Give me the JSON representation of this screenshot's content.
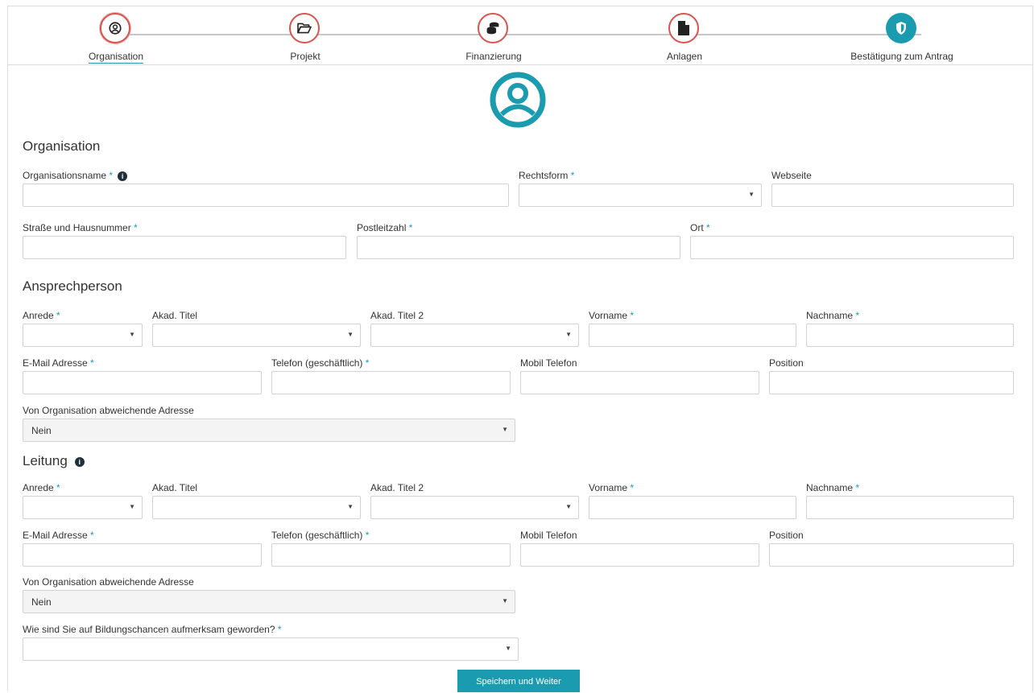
{
  "steps": [
    {
      "label": "Organisation",
      "icon": "user-circle-icon"
    },
    {
      "label": "Projekt",
      "icon": "folder-open-icon"
    },
    {
      "label": "Finanzierung",
      "icon": "coins-icon"
    },
    {
      "label": "Anlagen",
      "icon": "file-icon"
    },
    {
      "label": "Bestätigung zum Antrag",
      "icon": "shield-icon"
    }
  ],
  "colors": {
    "accent": "#1a9bb0",
    "step_border": "#d9534f",
    "text": "#333333"
  },
  "organisation": {
    "title": "Organisation",
    "name_label": "Organisationsname",
    "rechtsform_label": "Rechtsform",
    "webseite_label": "Webseite",
    "strasse_label": "Straße und Hausnummer",
    "plz_label": "Postleitzahl",
    "ort_label": "Ort"
  },
  "ansprechperson": {
    "title": "Ansprechperson",
    "anrede_label": "Anrede",
    "titel_label": "Akad. Titel",
    "titel2_label": "Akad. Titel 2",
    "vorname_label": "Vorname",
    "nachname_label": "Nachname",
    "email_label": "E-Mail Adresse",
    "telefon_label": "Telefon (geschäftlich)",
    "mobil_label": "Mobil Telefon",
    "position_label": "Position",
    "abweichend_label": "Von Organisation abweichende Adresse",
    "abweichend_value": "Nein"
  },
  "leitung": {
    "title": "Leitung",
    "anrede_label": "Anrede",
    "titel_label": "Akad. Titel",
    "titel2_label": "Akad. Titel 2",
    "vorname_label": "Vorname",
    "nachname_label": "Nachname",
    "email_label": "E-Mail Adresse",
    "telefon_label": "Telefon (geschäftlich)",
    "mobil_label": "Mobil Telefon",
    "position_label": "Position",
    "abweichend_label": "Von Organisation abweichende Adresse",
    "abweichend_value": "Nein"
  },
  "aufmerksam_label": "Wie sind Sie auf Bildungschancen aufmerksam geworden?",
  "required_mark": "*",
  "info_mark": "i",
  "caret": "▼",
  "submit_label": "Speichern und Weiter"
}
